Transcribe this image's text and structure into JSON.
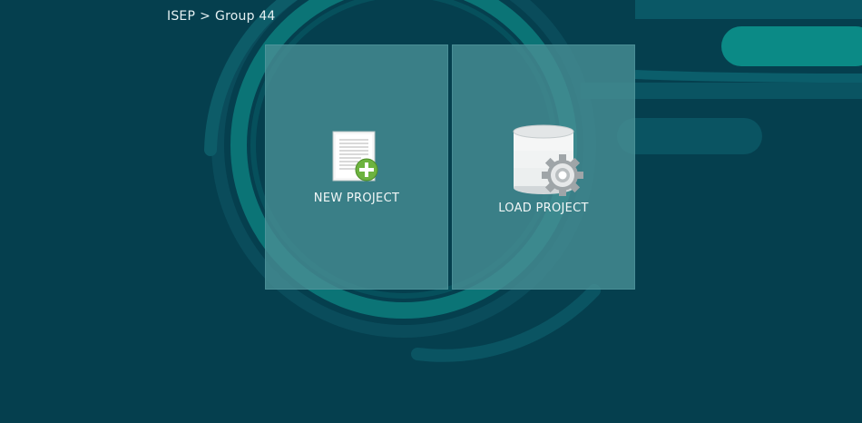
{
  "breadcrumb": {
    "root": "ISEP",
    "separator": ">",
    "current": "Group 44"
  },
  "tiles": [
    {
      "label": "NEW PROJECT",
      "icon": "new-document-icon"
    },
    {
      "label": "LOAD PROJECT",
      "icon": "database-gear-icon"
    }
  ],
  "colors": {
    "background": "#053f4e",
    "tile": "#478e94",
    "accent": "#0b8a86",
    "text": "#f2f7f7"
  }
}
